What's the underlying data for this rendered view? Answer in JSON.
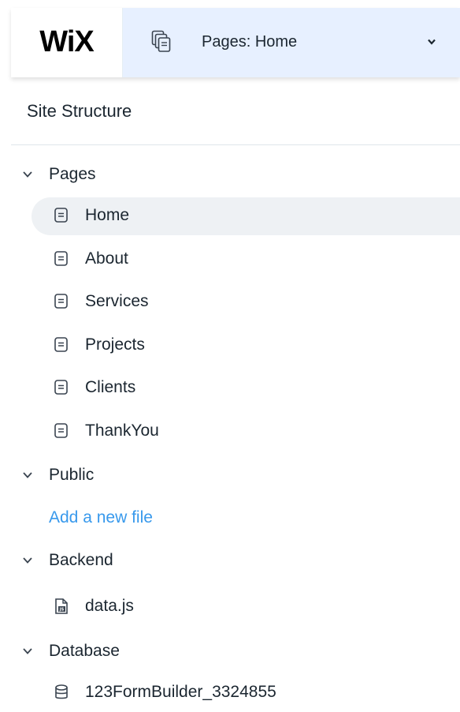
{
  "header": {
    "logo_text": "WiX",
    "page_selector_label": "Pages: Home",
    "pages_icon": "pages-stack-icon",
    "chevron_icon": "chevron-down-icon"
  },
  "site_structure": {
    "title": "Site Structure"
  },
  "groups": {
    "pages": {
      "label": "Pages",
      "items": [
        {
          "label": "Home",
          "icon": "page-icon",
          "selected": true
        },
        {
          "label": "About",
          "icon": "page-icon"
        },
        {
          "label": "Services",
          "icon": "page-icon"
        },
        {
          "label": "Projects",
          "icon": "page-icon"
        },
        {
          "label": "Clients",
          "icon": "page-icon"
        },
        {
          "label": "ThankYou",
          "icon": "page-icon"
        }
      ]
    },
    "public": {
      "label": "Public",
      "add_link": "Add a new file"
    },
    "backend": {
      "label": "Backend",
      "items": [
        {
          "label": "data.js",
          "icon": "js-file-icon"
        }
      ]
    },
    "database": {
      "label": "Database",
      "items": [
        {
          "label": "123FormBuilder_3324855",
          "icon": "database-icon"
        }
      ]
    }
  },
  "colors": {
    "selector_bg": "#e7f0ff",
    "selected_row_bg": "#eef1f4",
    "link": "#3899ec",
    "text": "#1b2630"
  }
}
